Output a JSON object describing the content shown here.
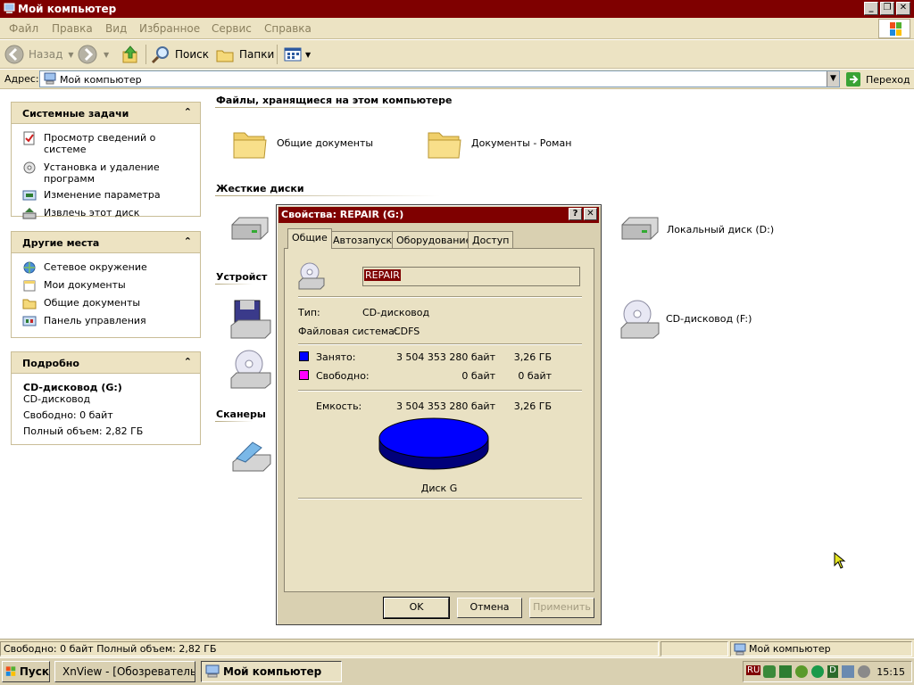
{
  "window": {
    "title": "Мой компьютер"
  },
  "menu": [
    "Файл",
    "Правка",
    "Вид",
    "Избранное",
    "Сервис",
    "Справка"
  ],
  "toolbar": {
    "back": "Назад",
    "search": "Поиск",
    "folders": "Папки"
  },
  "address": {
    "label": "Адрес:",
    "value": "Мой компьютер",
    "go": "Переход"
  },
  "panels": {
    "system": {
      "title": "Системные задачи",
      "items": [
        "Просмотр сведений о системе",
        "Установка и удаление программ",
        "Изменение параметра",
        "Извлечь этот диск"
      ]
    },
    "places": {
      "title": "Другие места",
      "items": [
        "Сетевое окружение",
        "Мои документы",
        "Общие документы",
        "Панель управления"
      ]
    },
    "details": {
      "title": "Подробно",
      "name": "CD-дисковод (G:)",
      "type": "CD-дисковод",
      "free": "Свободно: 0 байт",
      "total": "Полный объем: 2,82 ГБ"
    }
  },
  "main": {
    "sec_files": "Файлы, хранящиеся на этом компьютере",
    "shared_docs": "Общие документы",
    "roman_docs": "Документы - Роман",
    "sec_hdd": "Жесткие диски",
    "disk_d": "Локальный диск (D:)",
    "sec_devices": "Устройст",
    "cd_f": "CD-дисковод (F:)",
    "sec_scanners": "Сканеры"
  },
  "dialog": {
    "title": "Свойства: REPAIR (G:)",
    "help": "?",
    "close": "✕",
    "tabs": [
      "Общие",
      "Автозапуск",
      "Оборудование",
      "Доступ"
    ],
    "label": "REPAIR",
    "type_label": "Тип:",
    "type_value": "CD-дисковод",
    "fs_label": "Файловая система:",
    "fs_value": "CDFS",
    "used_label": "Занято:",
    "used_bytes": "3 504 353 280 байт",
    "used_gb": "3,26 ГБ",
    "free_label": "Свободно:",
    "free_bytes": "0 байт",
    "free_gb": "0 байт",
    "cap_label": "Емкость:",
    "cap_bytes": "3 504 353 280 байт",
    "cap_gb": "3,26 ГБ",
    "disk_caption": "Диск G",
    "ok": "OK",
    "cancel": "Отмена",
    "apply": "Применить",
    "used_color": "#0000ff",
    "free_color": "#ff00ff"
  },
  "status": {
    "left": "Свободно: 0 байт Полный объем: 2,82 ГБ",
    "right": "Мой компьютер"
  },
  "taskbar": {
    "start": "Пуск",
    "task1": "XnView - [Обозреватель...",
    "task2": "Мой компьютер",
    "lang": "RU",
    "clock": "15:15"
  },
  "colors": {
    "title_bar": "#7f0000",
    "menu_bg": "#ece3c3"
  }
}
